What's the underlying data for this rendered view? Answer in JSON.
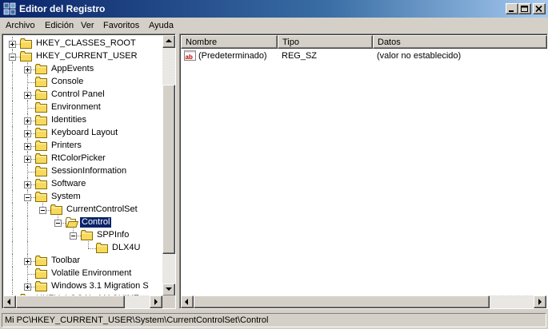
{
  "window": {
    "title": "Editor del Registro",
    "controls": [
      "minimize",
      "maximize",
      "close"
    ]
  },
  "menu": [
    "Archivo",
    "Edición",
    "Ver",
    "Favoritos",
    "Ayuda"
  ],
  "tree": {
    "nodes": [
      {
        "label": "HKEY_CLASSES_ROOT",
        "level": 1,
        "expander": "plus"
      },
      {
        "label": "HKEY_CURRENT_USER",
        "level": 1,
        "expander": "minus"
      },
      {
        "label": "AppEvents",
        "level": 2,
        "expander": "plus"
      },
      {
        "label": "Console",
        "level": 2,
        "expander": "none"
      },
      {
        "label": "Control Panel",
        "level": 2,
        "expander": "plus"
      },
      {
        "label": "Environment",
        "level": 2,
        "expander": "none"
      },
      {
        "label": "Identities",
        "level": 2,
        "expander": "plus"
      },
      {
        "label": "Keyboard Layout",
        "level": 2,
        "expander": "plus"
      },
      {
        "label": "Printers",
        "level": 2,
        "expander": "plus"
      },
      {
        "label": "RtColorPicker",
        "level": 2,
        "expander": "plus"
      },
      {
        "label": "SessionInformation",
        "level": 2,
        "expander": "none"
      },
      {
        "label": "Software",
        "level": 2,
        "expander": "plus"
      },
      {
        "label": "System",
        "level": 2,
        "expander": "minus"
      },
      {
        "label": "CurrentControlSet",
        "level": 3,
        "expander": "minus"
      },
      {
        "label": "Control",
        "level": 4,
        "expander": "minus",
        "selected": true,
        "open": true
      },
      {
        "label": "SPPInfo",
        "level": 5,
        "expander": "minus"
      },
      {
        "label": "DLX4U",
        "level": 6,
        "expander": "none"
      },
      {
        "label": "Toolbar",
        "level": 2,
        "expander": "plus"
      },
      {
        "label": "Volatile Environment",
        "level": 2,
        "expander": "none"
      },
      {
        "label": "Windows 3.1 Migration S",
        "level": 2,
        "expander": "plus"
      },
      {
        "label": "HKEY_LOCAL_MACHINE",
        "level": 1,
        "expander": "plus"
      }
    ]
  },
  "list": {
    "columns": [
      "Nombre",
      "Tipo",
      "Datos"
    ],
    "rows": [
      {
        "name": "(Predeterminado)",
        "type": "REG_SZ",
        "data": "(valor no establecido)",
        "icon": "string-value-icon",
        "icon_text": "ab"
      }
    ]
  },
  "status": {
    "path": "Mi PC\\HKEY_CURRENT_USER\\System\\CurrentControlSet\\Control"
  },
  "colors": {
    "titlebar_start": "#0a246a",
    "titlebar_end": "#a6caf0",
    "selection": "#0a246a",
    "face": "#d4d0c8",
    "folder": "#f7d95c"
  },
  "scroll": {
    "tree_vertical_position": 0.55,
    "tree_vertical_visible": 0.72
  }
}
